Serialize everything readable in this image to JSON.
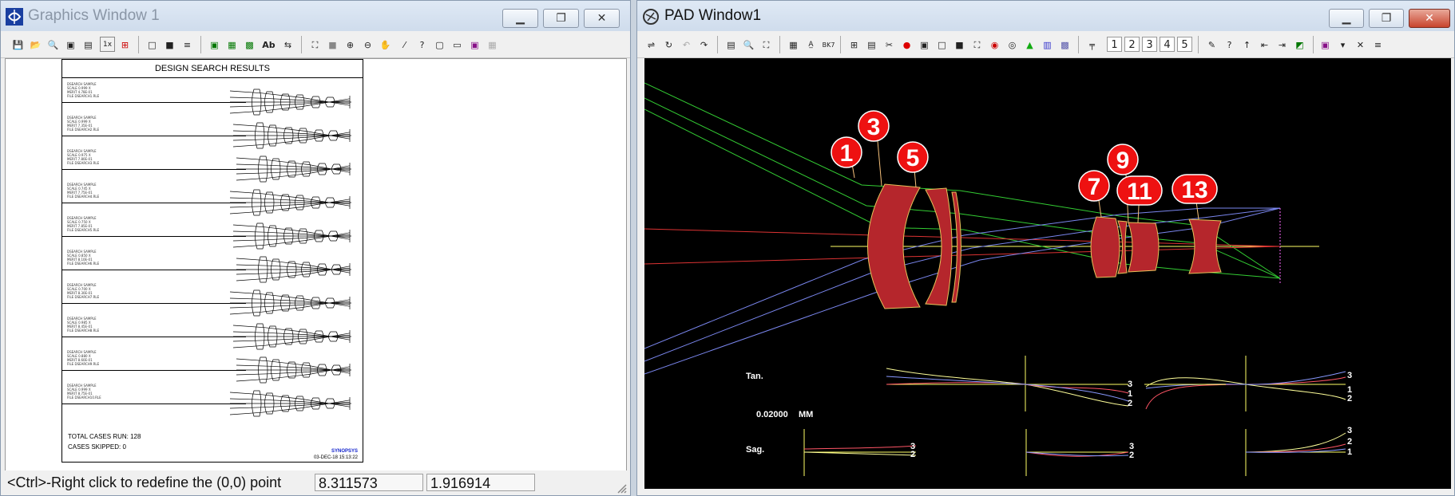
{
  "graphics_window": {
    "title": "Graphics Window 1",
    "toolbar_icons": [
      "save-icon",
      "open-icon",
      "zoom-icon",
      "print-icon",
      "preview-icon",
      "scale-1x-icon",
      "grid-icon",
      "white-box-icon",
      "black-box-icon",
      "lines-icon",
      "photo-icon",
      "chart-icon",
      "chart-icon",
      "text-icon",
      "arrows-icon",
      "fit-icon",
      "gray-box-icon",
      "zoom-in-icon",
      "zoom-out-icon",
      "pan-icon",
      "wand-icon",
      "help-icon",
      "frame-icon",
      "window-icon",
      "paste-icon",
      "disabled-icon"
    ],
    "document": {
      "title": "DESIGN SEARCH RESULTS",
      "cases": [
        {
          "label": [
            "DSEARCH SAMPLE",
            "SCALE  0.999 X",
            "MERIT 4.78E-01",
            "FILE DSEARCH1.RLE"
          ]
        },
        {
          "label": [
            "DSEARCH SAMPLE",
            "SCALE  0.999 X",
            "MERIT 7.35E-01",
            "FILE DSEARCH2.RLE"
          ]
        },
        {
          "label": [
            "DSEARCH SAMPLE",
            "SCALE  0.975 X",
            "MERIT 7.80E-01",
            "FILE DSEARCH3.RLE"
          ]
        },
        {
          "label": [
            "DSEARCH SAMPLE",
            "SCALE  0.745 X",
            "MERIT 7.75E-01",
            "FILE DSEARCH4.RLE"
          ]
        },
        {
          "label": [
            "DSEARCH SAMPLE",
            "SCALE  0.750 X",
            "MERIT 7.85E-01",
            "FILE DSEARCH5.RLE"
          ]
        },
        {
          "label": [
            "DSEARCH SAMPLE",
            "SCALE  0.850 X",
            "MERIT 8.10E-01",
            "FILE DSEARCH6.RLE"
          ]
        },
        {
          "label": [
            "DSEARCH SAMPLE",
            "SCALE  0.700 X",
            "MERIT 8.30E-01",
            "FILE DSEARCH7.RLE"
          ]
        },
        {
          "label": [
            "DSEARCH SAMPLE",
            "SCALE  0.985 X",
            "MERIT 8.45E-01",
            "FILE DSEARCH8.RLE"
          ]
        },
        {
          "label": [
            "DSEARCH SAMPLE",
            "SCALE  0.880 X",
            "MERIT 8.60E-01",
            "FILE DSEARCH9.RLE"
          ]
        },
        {
          "label": [
            "DSEARCH SAMPLE",
            "SCALE  0.999 X",
            "MERIT 8.75E-01",
            "FILE DSEARCH10.RLE"
          ]
        }
      ],
      "total_cases_label": "TOTAL CASES RUN:   128",
      "cases_skipped_label": "CASES SKIPPED:  0",
      "brand": "SYNOPSYS",
      "timestamp": "03-DEC-18  15:13:22"
    },
    "status": {
      "hint": "<Ctrl>-Right click to redefine the (0,0) point",
      "x": "8.311573",
      "y": "1.916914"
    }
  },
  "pad_window": {
    "title": "PAD Window1",
    "toolbar_numbers": [
      "1",
      "2",
      "3",
      "4",
      "5"
    ],
    "surface_labels": [
      "1",
      "3",
      "5",
      "7",
      "9",
      "11",
      "13"
    ],
    "tan_label": "Tan.",
    "sag_label": "Sag.",
    "scale_value": "0.02000",
    "scale_unit": "MM",
    "tan_curve_labels": [
      "3",
      "1",
      "2"
    ],
    "sag_curve_labels": [
      "3",
      "2"
    ],
    "colors": {
      "lens": "#b5262c",
      "ray_green": "#33cc33",
      "ray_red": "#dd3333",
      "ray_blue": "#7a86ee",
      "axis": "#ffff66"
    }
  }
}
